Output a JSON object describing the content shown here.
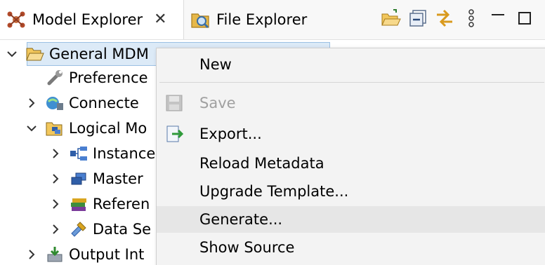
{
  "tabs": {
    "model_explorer": {
      "label": "Model Explorer",
      "close": "✕"
    },
    "file_explorer": {
      "label": "File Explorer"
    }
  },
  "toolbar": {
    "icons": [
      "open-folder-icon",
      "collapse-all-icon",
      "link-editor-icon",
      "view-menu-icon",
      "minimize-icon",
      "maximize-icon"
    ]
  },
  "tree": {
    "items": [
      {
        "label": "General MDM",
        "expanded": true,
        "selected": true,
        "icon": "open-folder-icon"
      },
      {
        "label": "Preference",
        "icon": "wrench-icon"
      },
      {
        "label": "Connecte",
        "icon": "connection-icon"
      },
      {
        "label": "Logical Mo",
        "expanded": true,
        "icon": "logical-model-icon"
      },
      {
        "label": "Instance",
        "icon": "instance-icon"
      },
      {
        "label": "Master",
        "icon": "master-icon"
      },
      {
        "label": "Referen",
        "icon": "reference-books-icon"
      },
      {
        "label": "Data Se",
        "icon": "data-set-icon"
      },
      {
        "label": "Output Int",
        "icon": "output-icon"
      }
    ]
  },
  "context_menu": {
    "items": [
      {
        "label": "New",
        "enabled": true
      },
      {
        "label": "Save",
        "enabled": false,
        "icon": "save-icon"
      },
      {
        "label": "Export...",
        "enabled": true,
        "icon": "export-icon"
      },
      {
        "label": "Reload Metadata",
        "enabled": true
      },
      {
        "label": "Upgrade Template...",
        "enabled": true
      },
      {
        "label": "Generate...",
        "enabled": true,
        "highlighted": true
      },
      {
        "label": "Show Source",
        "enabled": true
      }
    ]
  },
  "colors": {
    "selection_bg": "#dceaf7",
    "selection_border": "#9bc0e3",
    "menu_bg": "#f3f3f3",
    "menu_hover": "#e6e6e6",
    "disabled_text": "#a0a0a0"
  }
}
